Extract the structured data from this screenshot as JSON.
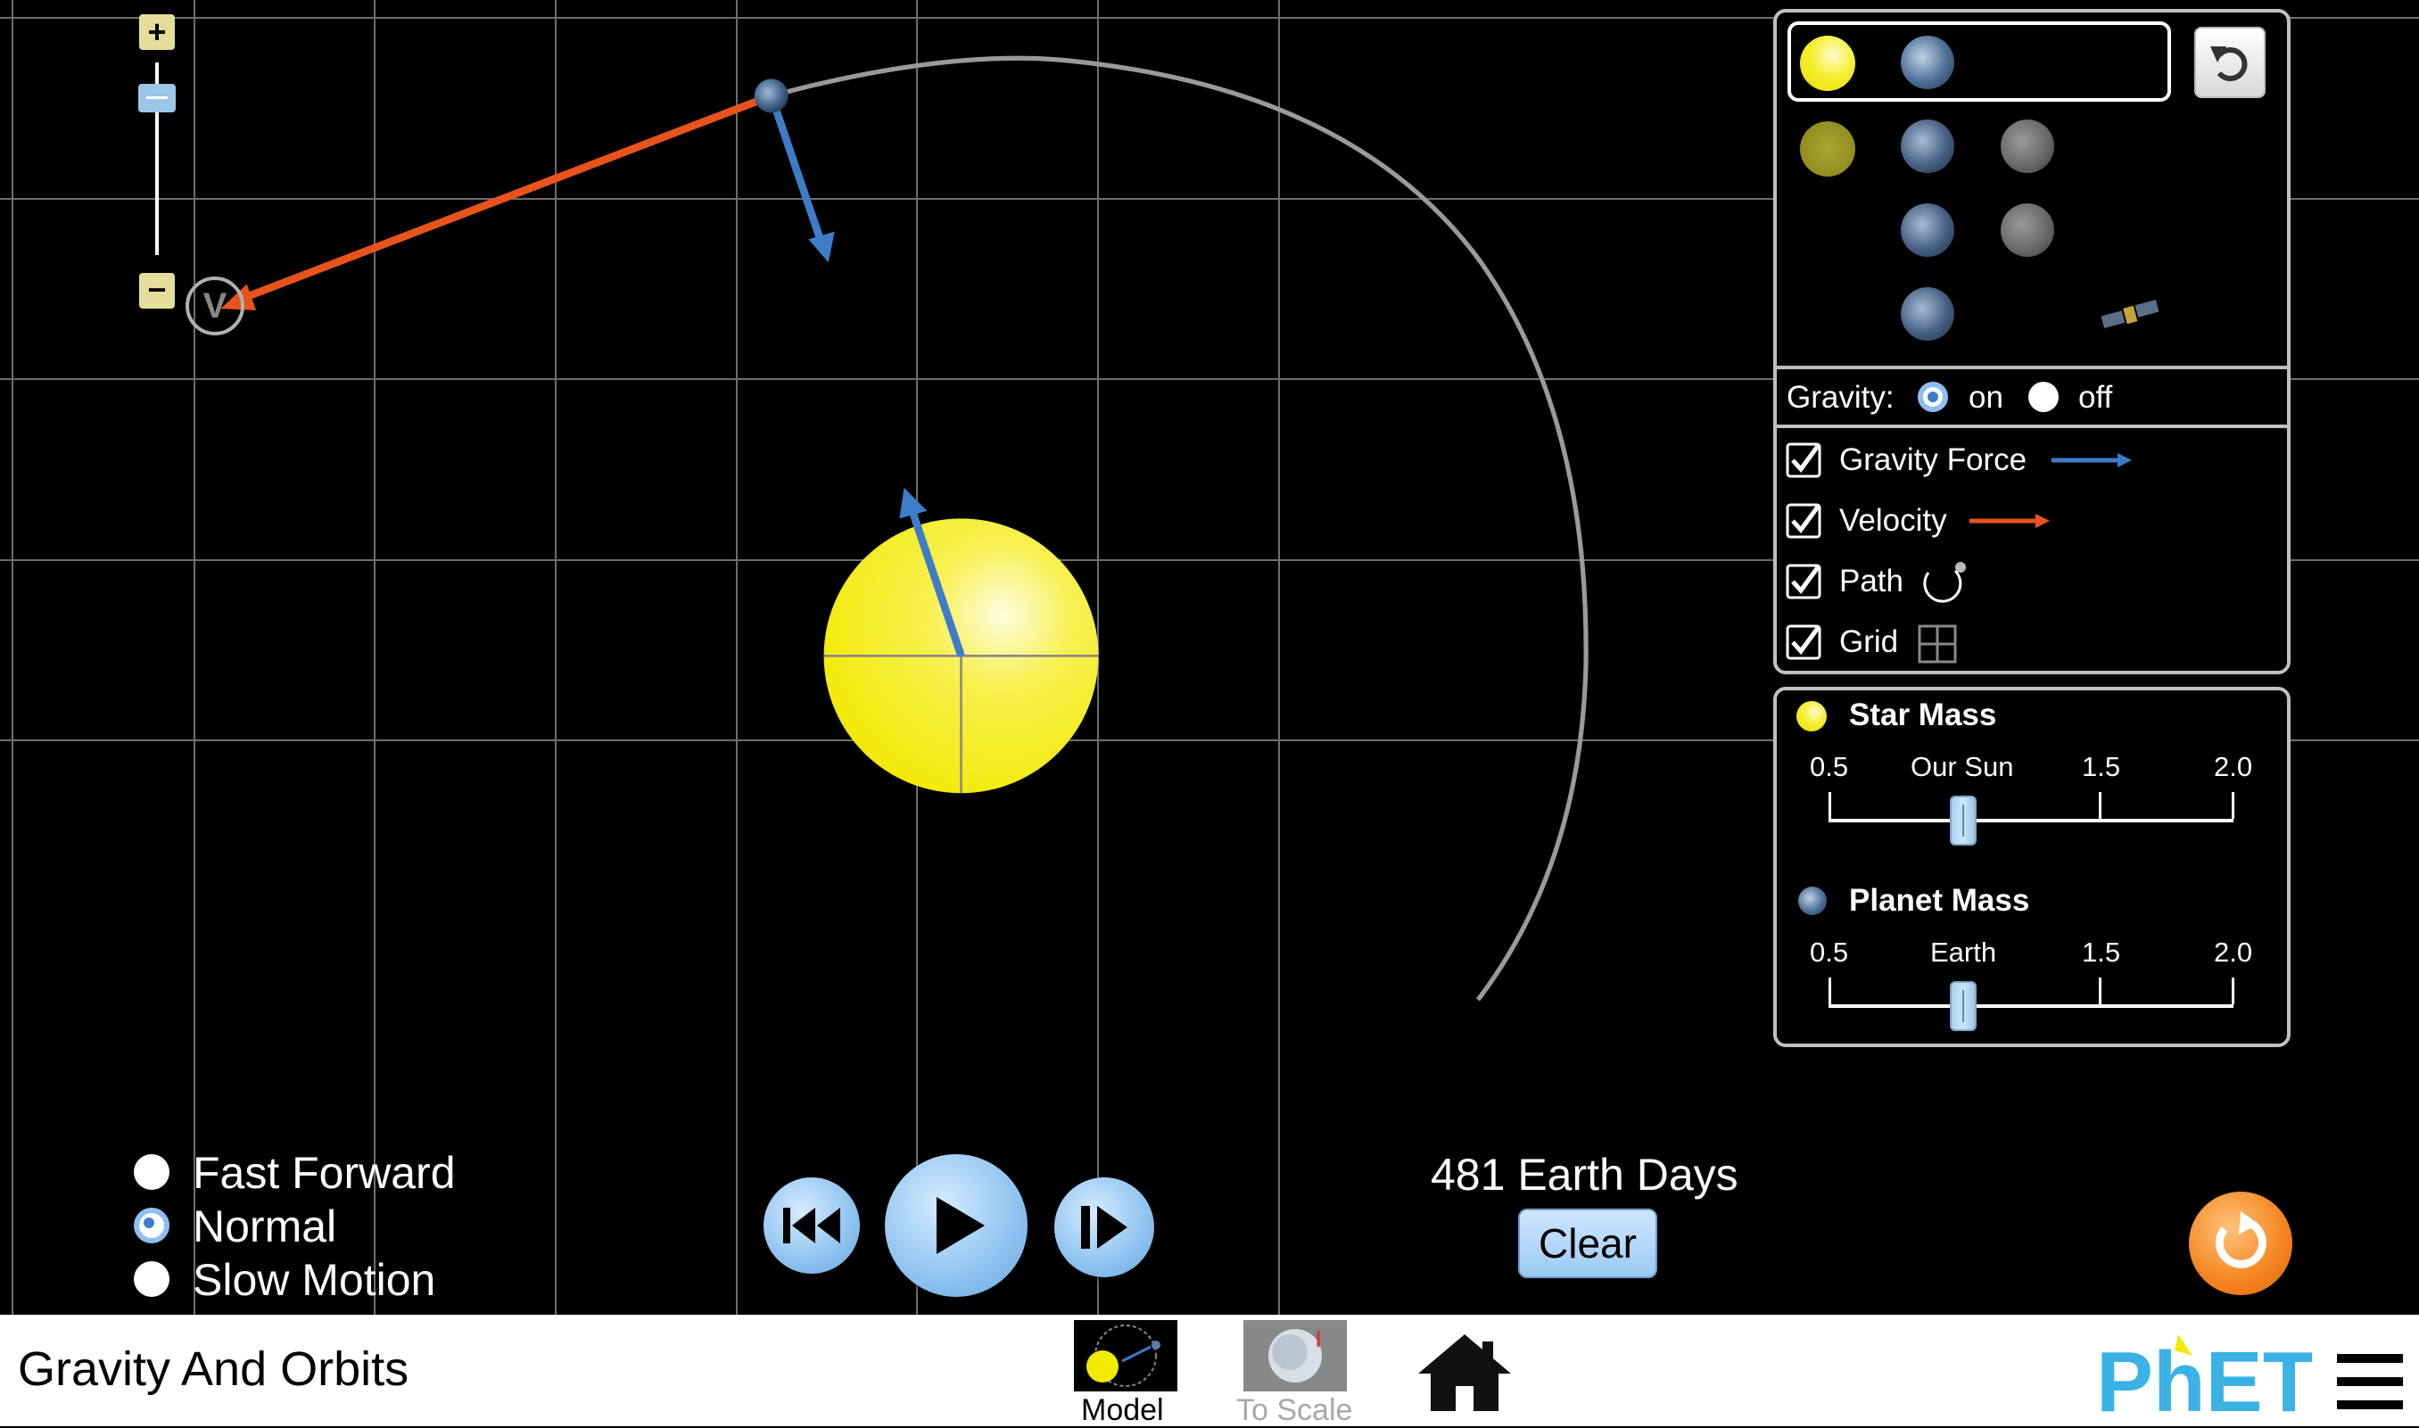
{
  "app": {
    "title": "Gravity And Orbits"
  },
  "zoom": {
    "plus_label": "+",
    "minus_label": "−"
  },
  "velocity_marker": {
    "label": "V"
  },
  "bodies_panel": {
    "icons": [
      "sun-icon",
      "earth-icon",
      "moon-icon",
      "satellite-icon"
    ]
  },
  "gravity": {
    "label": "Gravity:",
    "on_label": "on",
    "off_label": "off",
    "selected": "on"
  },
  "display_options": [
    {
      "label": "Gravity Force",
      "checked": true,
      "color": "#3d7cc9"
    },
    {
      "label": "Velocity",
      "checked": true,
      "color": "#e8531c"
    },
    {
      "label": "Path",
      "checked": true
    },
    {
      "label": "Grid",
      "checked": true
    }
  ],
  "star_mass": {
    "title": "Star Mass",
    "ticks": [
      "0.5",
      "Our Sun",
      "1.5",
      "2.0"
    ],
    "value": 1.0
  },
  "planet_mass": {
    "title": "Planet Mass",
    "ticks": [
      "0.5",
      "Earth",
      "1.5",
      "2.0"
    ],
    "value": 1.0
  },
  "speed": {
    "options": [
      "Fast Forward",
      "Normal",
      "Slow Motion"
    ],
    "selected": "Normal"
  },
  "timer": {
    "text": "481 Earth Days",
    "clear_label": "Clear"
  },
  "screens": [
    {
      "label": "Model",
      "active": true
    },
    {
      "label": "To Scale",
      "active": false
    }
  ],
  "colors": {
    "sun": "#f2ea00",
    "velocity": "#e8531c",
    "gravity": "#3d7cc9",
    "accent_orange": "#f5841f",
    "phet_blue": "#3ab2e6"
  }
}
